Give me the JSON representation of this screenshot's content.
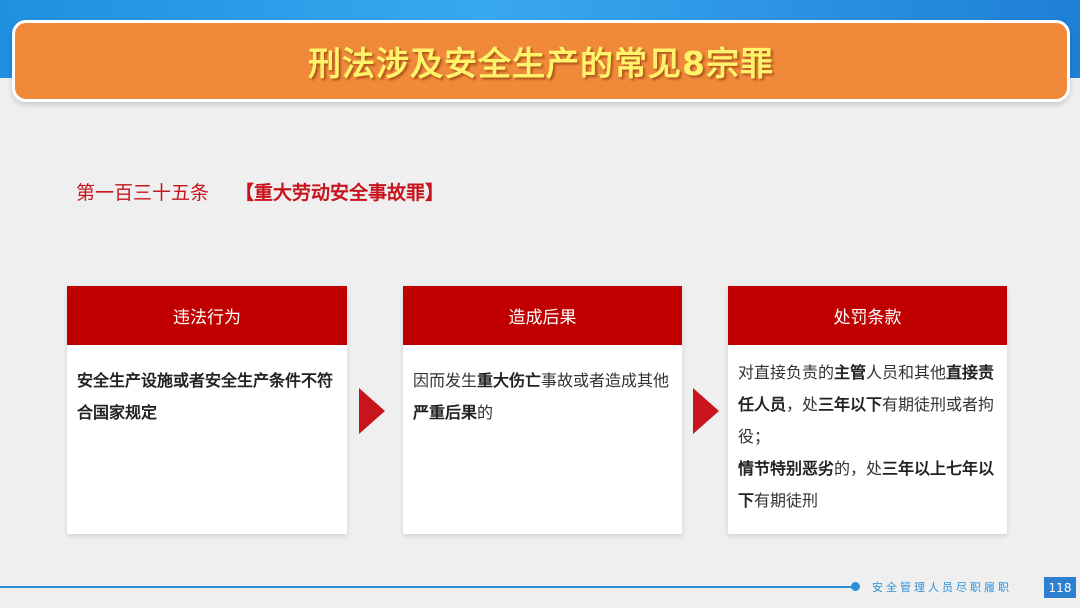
{
  "title": "刑法涉及安全生产的常见8宗罪",
  "article": {
    "number": "第一百三十五条",
    "crime": "【重大劳动安全事故罪】"
  },
  "cards": [
    {
      "heading": "违法行为",
      "lines": [
        [
          {
            "t": "安全生产设施或者安全生产条件不符合国家规定",
            "b": true
          }
        ]
      ]
    },
    {
      "heading": "造成后果",
      "lines": [
        [
          {
            "t": "因而发生",
            "b": false
          },
          {
            "t": "重大伤亡",
            "b": true
          },
          {
            "t": "事故或者造成其他",
            "b": false
          },
          {
            "t": "严重后果",
            "b": true
          },
          {
            "t": "的",
            "b": false
          }
        ]
      ]
    },
    {
      "heading": "处罚条款",
      "lines": [
        [
          {
            "t": "对直接负责的",
            "b": false
          },
          {
            "t": "主管",
            "b": true
          },
          {
            "t": "人员和其他",
            "b": false
          },
          {
            "t": "直接责任人员",
            "b": true
          },
          {
            "t": "，处",
            "b": false
          },
          {
            "t": "三年以下",
            "b": true
          },
          {
            "t": "有期徒刑或者拘役；",
            "b": false
          }
        ],
        [
          {
            "t": "情节特别恶劣",
            "b": true
          },
          {
            "t": "的，处",
            "b": false
          },
          {
            "t": "三年以上七年以下",
            "b": true
          },
          {
            "t": "有期徒刑",
            "b": false
          }
        ]
      ]
    }
  ],
  "footer": {
    "text": "安全管理人员尽职履职",
    "page": "118"
  },
  "colors": {
    "accent_red": "#c00000",
    "title_orange": "#f08a3a",
    "title_text": "#fff36b",
    "footer_blue": "#2d8fd8"
  }
}
